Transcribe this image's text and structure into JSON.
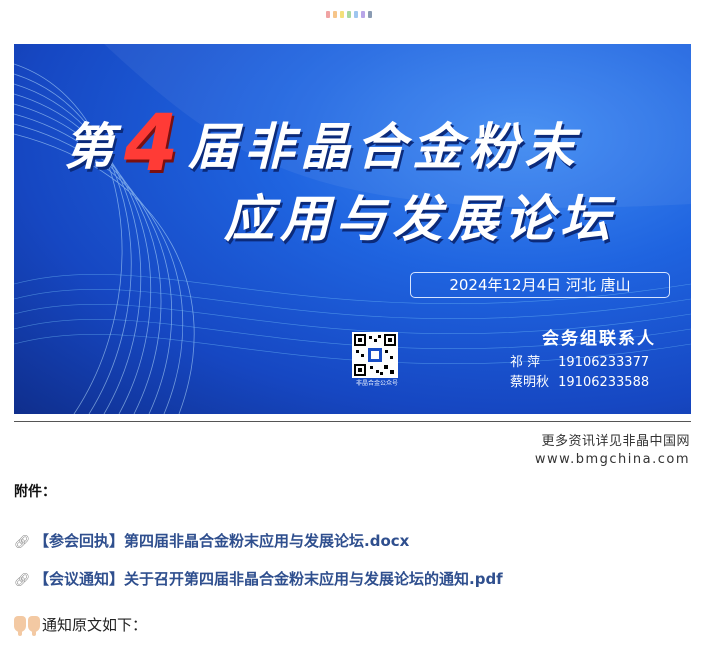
{
  "decor": {
    "dot_colors": [
      "#f0a3a3",
      "#f6c58a",
      "#f4e07a",
      "#a8d8a0",
      "#9ec6ef",
      "#b8a6e8",
      "#8a9bb3"
    ]
  },
  "banner": {
    "title_prefix": "第",
    "title_number": "4",
    "title_line1_rest": "届非晶合金粉末",
    "title_line2": "应用与发展论坛",
    "date_location": "2024年12月4日  河北 唐山",
    "contact_title": "会务组联系人",
    "contacts": [
      {
        "name": "祁   萍",
        "phone": "19106233377"
      },
      {
        "name": "蔡明秋",
        "phone": "19106233588"
      }
    ],
    "qr_caption": "非晶合金公众号"
  },
  "more_info": {
    "line1": "更多资讯详见非晶中国网",
    "line2": "www.bmgchina.com"
  },
  "attachments": {
    "label": "附件：",
    "files": [
      {
        "title": "【参会回执】第四届非晶合金粉末应用与发展论坛.docx"
      },
      {
        "title": "【会议通知】关于召开第四届非晶合金粉末应用与发展论坛的通知.pdf"
      }
    ]
  },
  "notice_text": "通知原文如下："
}
